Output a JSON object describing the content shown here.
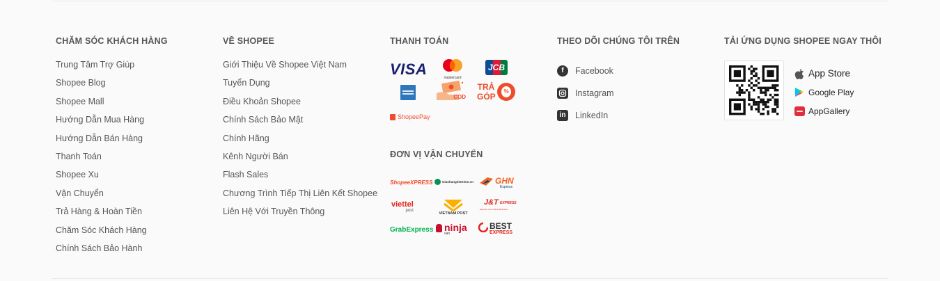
{
  "customer_care": {
    "title": "CHĂM SÓC KHÁCH HÀNG",
    "items": [
      "Trung Tâm Trợ Giúp",
      "Shopee Blog",
      "Shopee Mall",
      "Hướng Dẫn Mua Hàng",
      "Hướng Dẫn Bán Hàng",
      "Thanh Toán",
      "Shopee Xu",
      "Vận Chuyển",
      "Trả Hàng & Hoàn Tiền",
      "Chăm Sóc Khách Hàng",
      "Chính Sách Bảo Hành"
    ]
  },
  "about": {
    "title": "VỀ SHOPEE",
    "items": [
      "Giới Thiệu Về Shopee Việt Nam",
      "Tuyển Dụng",
      "Điều Khoản Shopee",
      "Chính Sách Bảo Mật",
      "Chính Hãng",
      "Kênh Người Bán",
      "Flash Sales",
      "Chương Trình Tiếp Thị Liên Kết Shopee",
      "Liên Hệ Với Truyền Thông"
    ]
  },
  "payment": {
    "title": "THANH TOÁN",
    "logos": {
      "visa": "VISA",
      "mastercard": "mastercard",
      "jcb": "JCB",
      "cod": "COD",
      "tra_gop_1": "TRẢ",
      "tra_gop_2": "GÓP",
      "shopeepay": "ShopeePay"
    }
  },
  "shipping": {
    "title": "ĐƠN VỊ VẬN CHUYỂN",
    "logos": {
      "spx": "ShopeeXPRESS",
      "ghtk": "GiaohangtietKiem.vn",
      "ghn": "GHN",
      "ghn_sub": "Express",
      "viettel": "viettel",
      "viettel_sub": "post",
      "vnpost": "VIETNAM POST",
      "jt": "J&T",
      "jt_express": "EXPRESS",
      "jt_sub": "Express Your Online Business",
      "grab": "GrabExpress",
      "ninja": "ninja",
      "ninja_sub": "van",
      "best": "BEST",
      "best_sub": "EXPRESS"
    }
  },
  "follow": {
    "title": "THEO DÕI CHÚNG TÔI TRÊN",
    "items": [
      {
        "label": "Facebook",
        "icon": "facebook-icon"
      },
      {
        "label": "Instagram",
        "icon": "instagram-icon"
      },
      {
        "label": "LinkedIn",
        "icon": "linkedin-icon"
      }
    ]
  },
  "download": {
    "title": "TẢI ỨNG DỤNG SHOPEE NGAY THÔI",
    "stores": [
      "App Store",
      "Google Play",
      "AppGallery"
    ]
  },
  "colors": {
    "text": "#555555",
    "shopee_orange": "#ee4d2d",
    "visa_blue": "#1a1f71",
    "divider": "#e8e8e8"
  }
}
